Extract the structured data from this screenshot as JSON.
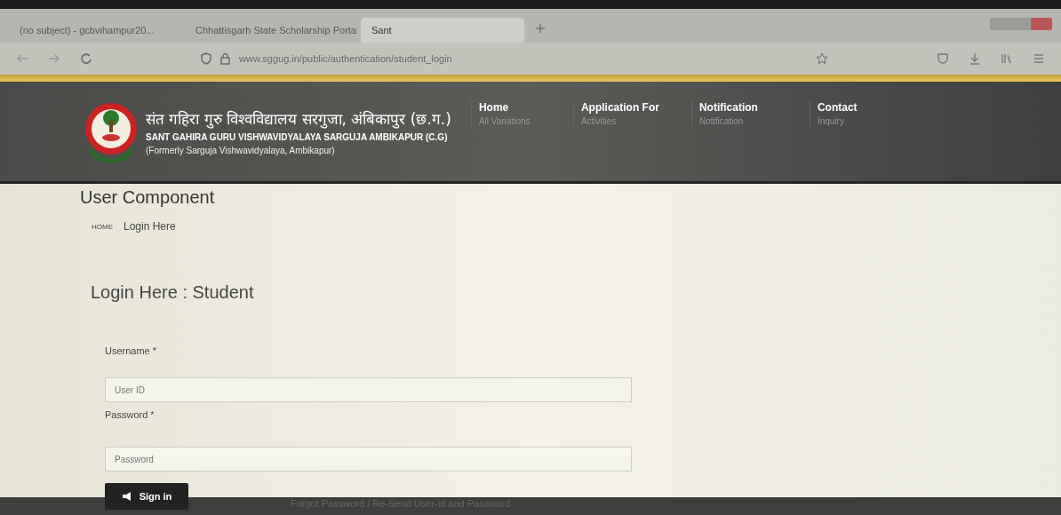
{
  "browser": {
    "tabs": [
      {
        "label": "(no subject) - gcbvihampur20...",
        "selected": false
      },
      {
        "label": "Chhattisgarh State Scholarship Portal",
        "selected": false
      },
      {
        "label": "Sant",
        "selected": true
      }
    ],
    "url": "www.sggug.in/public/authentication/student_login"
  },
  "header": {
    "title_hindi": "संत गहिरा गुरु विश्वविद्यालय सरगुजा, अंबिकापुर (छ.ग.)",
    "title_english": "SANT GAHIRA GURU VISHWAVIDYALAYA SARGUJA AMBIKAPUR (C.G)",
    "subtitle": "(Formerly Sarguja Vishwavidyalaya, Ambikapur)",
    "nav": [
      {
        "label": "Home",
        "sub": "All Variations"
      },
      {
        "label": "Application For",
        "sub": "Activities"
      },
      {
        "label": "Notification",
        "sub": "Notification"
      },
      {
        "label": "Contact",
        "sub": "Inquiry"
      }
    ]
  },
  "page_title": "User Component",
  "breadcrumb": [
    "HOME",
    "Login Here"
  ],
  "form": {
    "title": "Login Here : Student",
    "fields": [
      {
        "label": "Username *",
        "placeholder": "User ID"
      },
      {
        "label": "Password *",
        "placeholder": "Password"
      }
    ],
    "submit": "Sign in",
    "forgot_link": "Forgot Password / Re-Send User-id and Password"
  }
}
